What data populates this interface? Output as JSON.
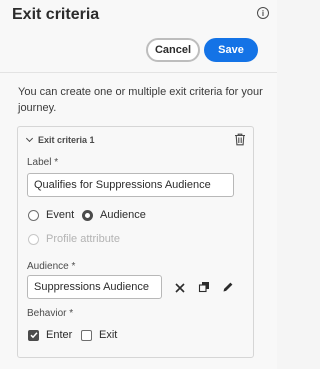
{
  "header": {
    "title": "Exit criteria",
    "info_glyph": "i",
    "cancel_label": "Cancel",
    "save_label": "Save"
  },
  "description": "You can create one or multiple exit criteria for your journey.",
  "criteria": {
    "heading": "Exit criteria 1",
    "label_field": {
      "label": "Label",
      "required_mark": "*",
      "value": "Qualifies for Suppressions Audience"
    },
    "source_options": [
      {
        "label": "Event",
        "selected": false,
        "disabled": false
      },
      {
        "label": "Audience",
        "selected": true,
        "disabled": false
      },
      {
        "label": "Profile attribute",
        "selected": false,
        "disabled": true
      }
    ],
    "audience_field": {
      "label": "Audience",
      "required_mark": "*",
      "value": "Suppressions Audience"
    },
    "behavior": {
      "label": "Behavior",
      "required_mark": "*",
      "options": [
        {
          "label": "Enter",
          "checked": true
        },
        {
          "label": "Exit",
          "checked": false
        }
      ]
    }
  },
  "icons": {
    "info": "info-icon",
    "chevron": "chevron-down-icon",
    "trash": "trash-icon",
    "clear": "close-icon",
    "copy": "copy-icon",
    "edit": "pencil-icon"
  },
  "colors": {
    "accent": "#1473e6",
    "text": "#2c2c2c"
  }
}
